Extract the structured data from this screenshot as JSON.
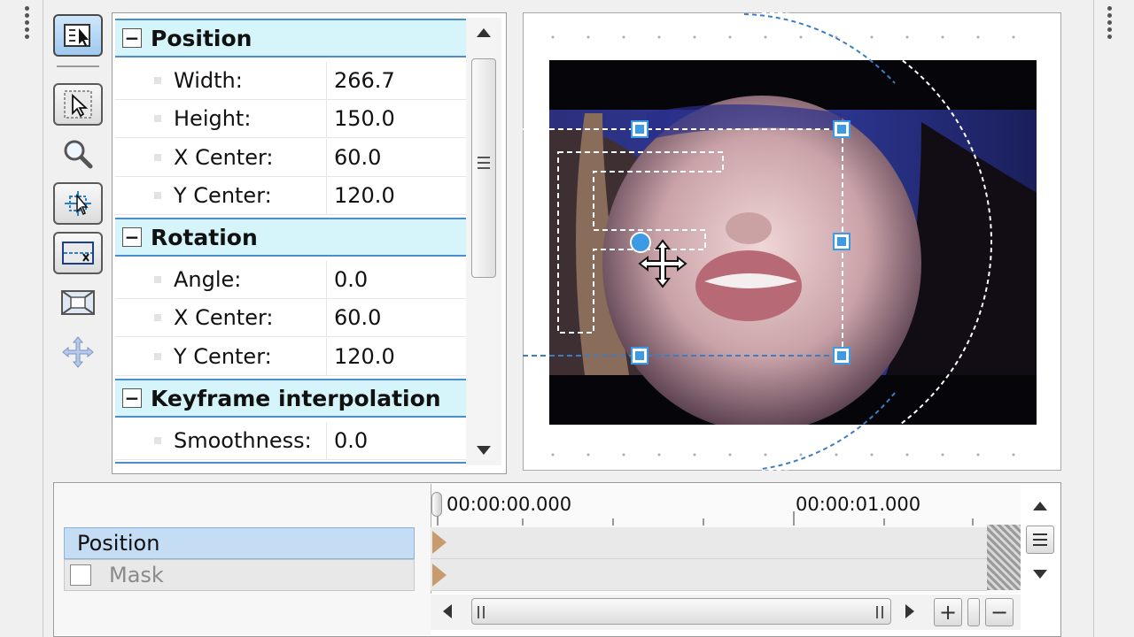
{
  "property_panel": {
    "categories": [
      {
        "title": "Position",
        "rows": [
          {
            "name": "Width:",
            "value": "266.7"
          },
          {
            "name": "Height:",
            "value": "150.0"
          },
          {
            "name": "X Center:",
            "value": "60.0"
          },
          {
            "name": "Y Center:",
            "value": "120.0"
          }
        ]
      },
      {
        "title": "Rotation",
        "rows": [
          {
            "name": "Angle:",
            "value": "0.0"
          },
          {
            "name": "X Center:",
            "value": "60.0"
          },
          {
            "name": "Y Center:",
            "value": "120.0"
          }
        ]
      },
      {
        "title": "Keyframe interpolation",
        "rows": [
          {
            "name": "Smoothness:",
            "value": "0.0"
          }
        ]
      }
    ],
    "collapse_glyph": "−"
  },
  "toolbar": {
    "tools": [
      "show-properties-icon",
      "normal-edit-icon",
      "zoom-icon",
      "enable-rotation-icon",
      "mask-icon",
      "fit-icon",
      "move-icon"
    ]
  },
  "timeline": {
    "timecodes": [
      "00:00:00.000",
      "00:00:01.000"
    ],
    "tracks": [
      {
        "label": "Position"
      },
      {
        "label": "Mask"
      }
    ],
    "zoom_in": "+",
    "zoom_out": "−"
  },
  "colors": {
    "category_bg": "#d6f5fb",
    "category_border": "#4a8ed0",
    "selection_handle": "#3d9be6",
    "track_selected": "#c4dcf4"
  }
}
